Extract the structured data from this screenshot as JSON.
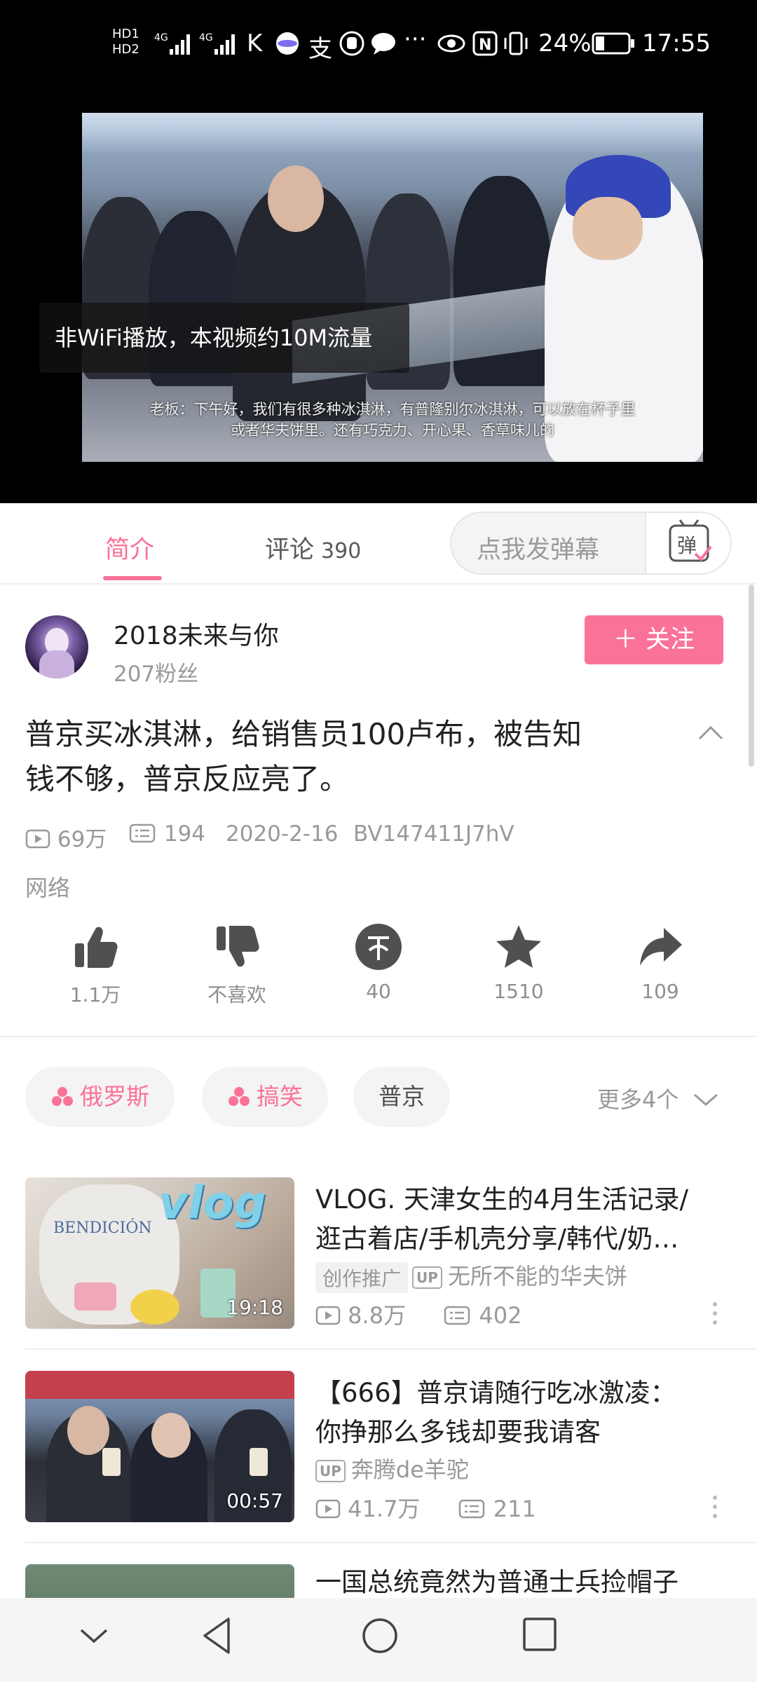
{
  "status_bar": {
    "network": "HD 4G 4G",
    "battery": "24%",
    "time": "17:55",
    "icons": [
      "hd-icon",
      "signal-icon",
      "signal-icon",
      "k-icon",
      "app-icon",
      "alipay-icon",
      "hand-icon",
      "chat-icon",
      "more-icon",
      "eye-icon",
      "nfc-icon",
      "vibrate-icon",
      "battery-icon"
    ]
  },
  "player": {
    "subtitle_line1": "老板：下午好，我们有很多种冰淇淋，有普隆别尔冰淇淋，可以放在杯子里",
    "subtitle_line2": "或者华夫饼里。还有巧克力、开心果、香草味儿的",
    "traffic_notice": "非WiFi播放，本视频约10M流量"
  },
  "tabs": {
    "intro": "简介",
    "comments": "评论",
    "comments_count": "390",
    "danmaku_placeholder": "点我发弹幕",
    "danmaku_button": "弹"
  },
  "uploader": {
    "name": "2018未来与你",
    "fans": "207粉丝",
    "follow_label": "＋ 关注"
  },
  "video": {
    "title_line1": "普京买冰淇淋，给销售员100卢布，被告知",
    "title_line2": "钱不够，普京反应亮了。",
    "views": "69万",
    "danmaku_count": "194",
    "date": "2020-2-16",
    "bvid": "BV147411J7hV",
    "partition": "网络"
  },
  "actions": {
    "like": "1.1万",
    "dislike": "不喜欢",
    "coin": "40",
    "favorite": "1510",
    "share": "109"
  },
  "tags": {
    "items": [
      "俄罗斯",
      "搞笑",
      "普京"
    ],
    "more": "更多4个"
  },
  "recommendations": [
    {
      "title_line1": "VLOG. 天津女生的4月生活记录/",
      "title_line2": "逛古着店/手机壳分享/韩代/奶…",
      "badge": "创作推广",
      "up_label": "UP",
      "owner": "无所不能的华夫饼",
      "views": "8.8万",
      "danmaku": "402",
      "duration": "19:18",
      "thumb_text": "vlog"
    },
    {
      "title_line1": "【666】普京请随行吃冰激凌：",
      "title_line2": "你挣那么多钱却要我请客",
      "up_label": "UP",
      "owner": "奔腾de羊驼",
      "views": "41.7万",
      "danmaku": "211",
      "duration": "00:57"
    },
    {
      "title_line1": "一国总统竟然为普通士兵捡帽子"
    }
  ]
}
